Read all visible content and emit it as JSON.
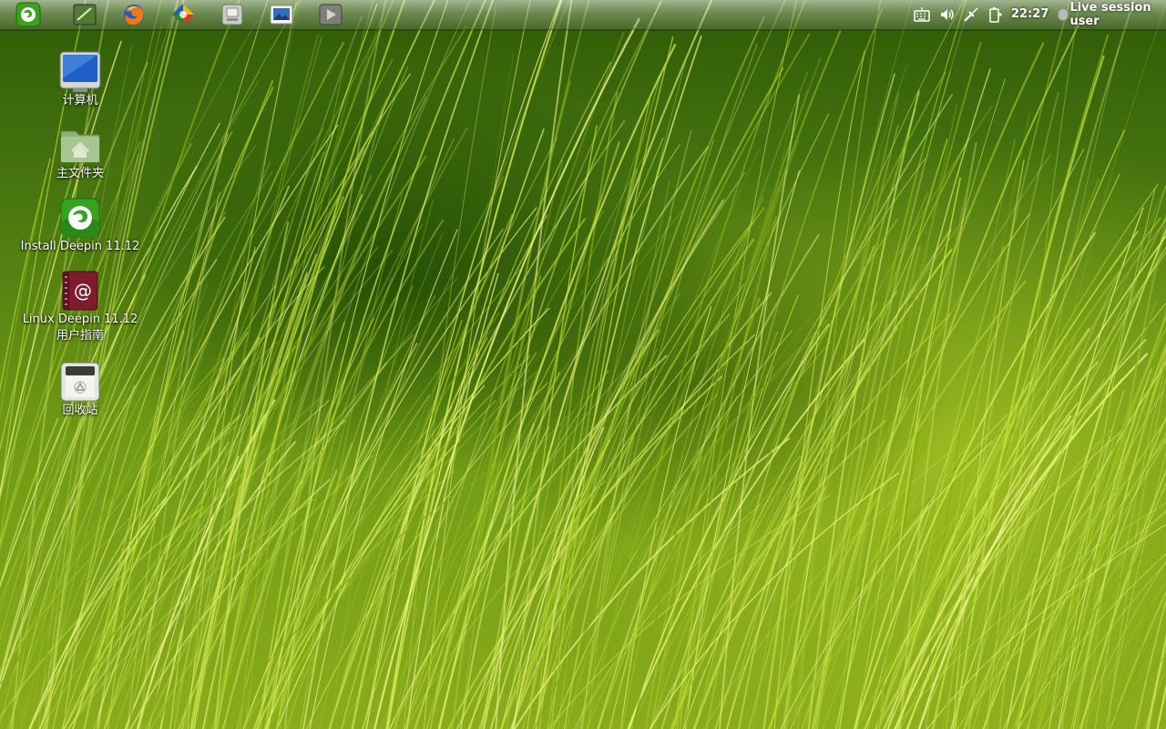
{
  "panel": {
    "launchers": [
      {
        "icon": "deepin-menu-icon"
      },
      {
        "icon": "terminal-icon"
      },
      {
        "icon": "firefox-icon"
      },
      {
        "icon": "media-player-icon"
      },
      {
        "icon": "file-manager-icon"
      },
      {
        "icon": "image-viewer-icon"
      },
      {
        "icon": "video-player-icon"
      }
    ],
    "tray": {
      "icons": [
        "keyboard-icon",
        "volume-icon",
        "network-icon",
        "battery-icon"
      ],
      "clock": "22:27",
      "user_label": "Live session user"
    }
  },
  "desktop": {
    "icons": [
      {
        "label": "计算机",
        "icon": "computer-icon"
      },
      {
        "label": "主文件夹",
        "icon": "home-folder-icon"
      },
      {
        "label": "Install Deepin 11.12",
        "icon": "deepin-installer-icon"
      },
      {
        "label_line1": "Linux Deepin 11.12",
        "label_line2": "用户指南",
        "icon": "user-guide-icon"
      },
      {
        "label": "回收站",
        "icon": "trash-icon"
      }
    ]
  },
  "colors": {
    "wallpaper_dark": "#2f5a08",
    "wallpaper_light": "#c8e03a",
    "deepin_green": "#3aa21c"
  }
}
